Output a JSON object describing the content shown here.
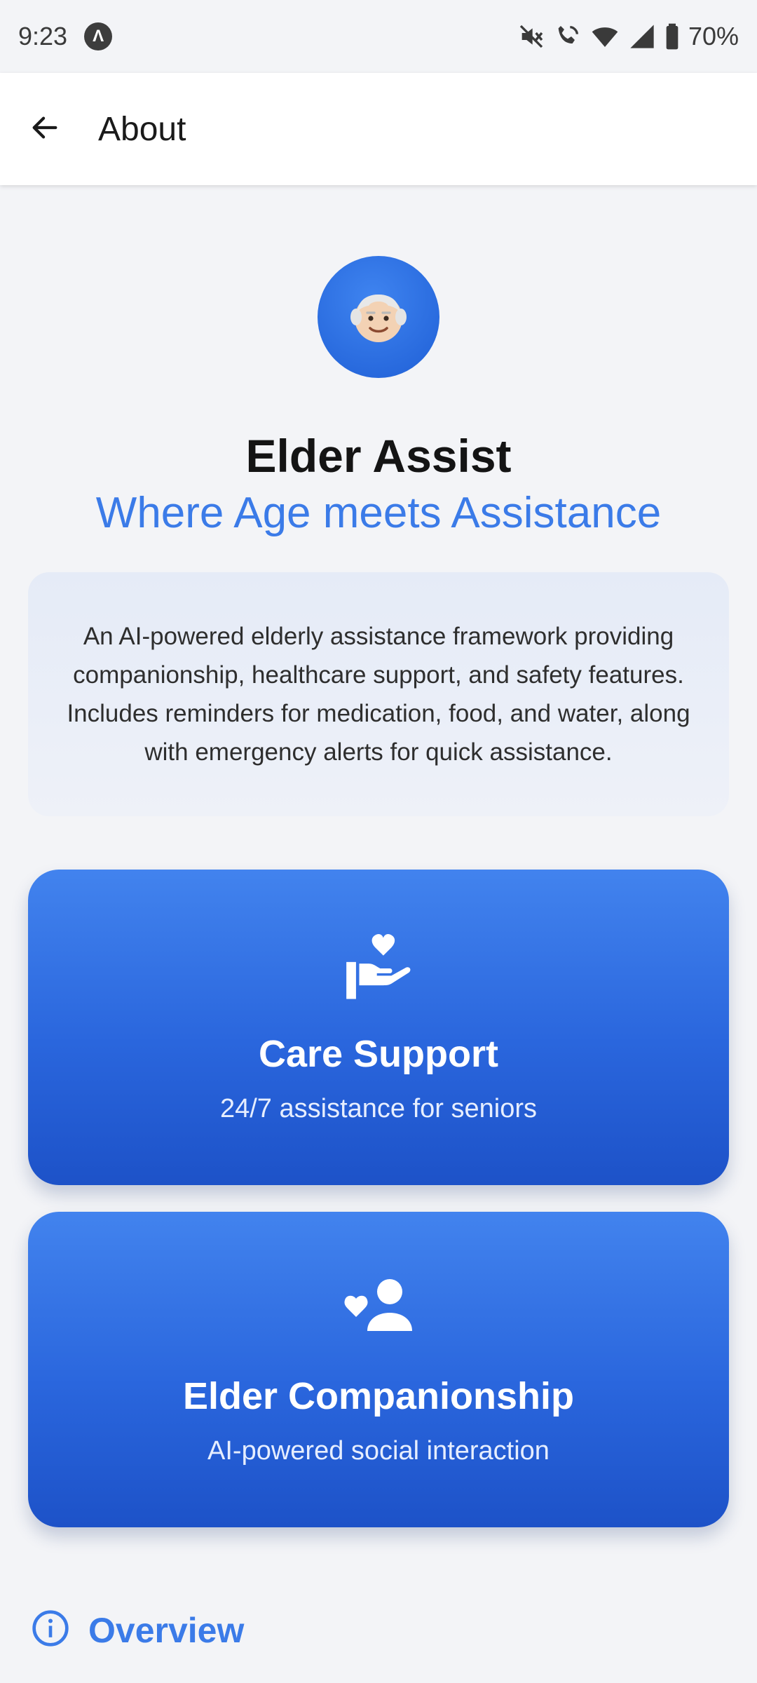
{
  "status_bar": {
    "time": "9:23",
    "app_icon_glyph": "Λ",
    "battery": "70%",
    "icons": [
      "mute-icon",
      "wifi-call-icon",
      "wifi-icon",
      "signal-icon",
      "battery-icon"
    ]
  },
  "app_bar": {
    "back_icon": "arrow-back-icon",
    "title": "About"
  },
  "app": {
    "logo_emoji": "👴🏻",
    "name": "Elder Assist",
    "tagline": "Where Age meets Assistance",
    "description": "An AI-powered elderly assistance framework providing companionship, healthcare support, and safety features. Includes reminders for medication, food, and water, along with emergency alerts for quick assistance."
  },
  "features": [
    {
      "icon": "hand-heart-icon",
      "title": "Care Support",
      "subtitle": "24/7 assistance for seniors"
    },
    {
      "icon": "heart-person-icon",
      "title": "Elder Companionship",
      "subtitle": "AI-powered social interaction"
    }
  ],
  "overview": {
    "icon": "info-icon",
    "title": "Overview"
  },
  "colors": {
    "accent": "#3b7be8",
    "card_top": "#4283ee",
    "card_bottom": "#1d52c8",
    "background": "#f3f4f7"
  }
}
